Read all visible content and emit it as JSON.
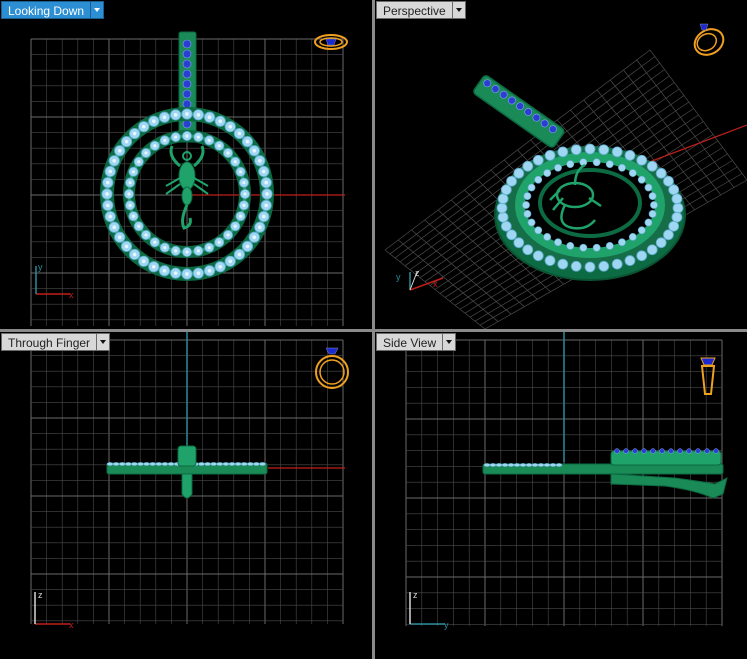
{
  "viewports": [
    {
      "id": "top",
      "label": "Looking Down",
      "active": true
    },
    {
      "id": "perspective",
      "label": "Perspective",
      "active": false
    },
    {
      "id": "front",
      "label": "Through Finger",
      "active": false
    },
    {
      "id": "side",
      "label": "Side View",
      "active": false
    }
  ],
  "axis_letters": {
    "top": [
      "y",
      "x"
    ],
    "perspective": [
      "y",
      "z",
      "x"
    ],
    "front": [
      "z",
      "x"
    ],
    "side": [
      "z",
      "y"
    ]
  },
  "colors": {
    "grid": "#4b4b4b",
    "grid_major": "#6a6a6a",
    "axis_x": "#c0201a",
    "axis_y": "#2a8a9a",
    "metal": "#1fa36a",
    "metal_dark": "#0c6b43",
    "gem": "#9fd6f2",
    "gem_blue": "#2a3fd0",
    "ring_icon": "#f0a020",
    "label_active_bg": "#2c8fd3",
    "label_bg": "#d8d8d8"
  },
  "icons": {
    "top": "ring-top-view-icon",
    "perspective": "ring-perspective-icon",
    "front": "ring-front-view-icon",
    "side": "ring-side-view-icon"
  }
}
